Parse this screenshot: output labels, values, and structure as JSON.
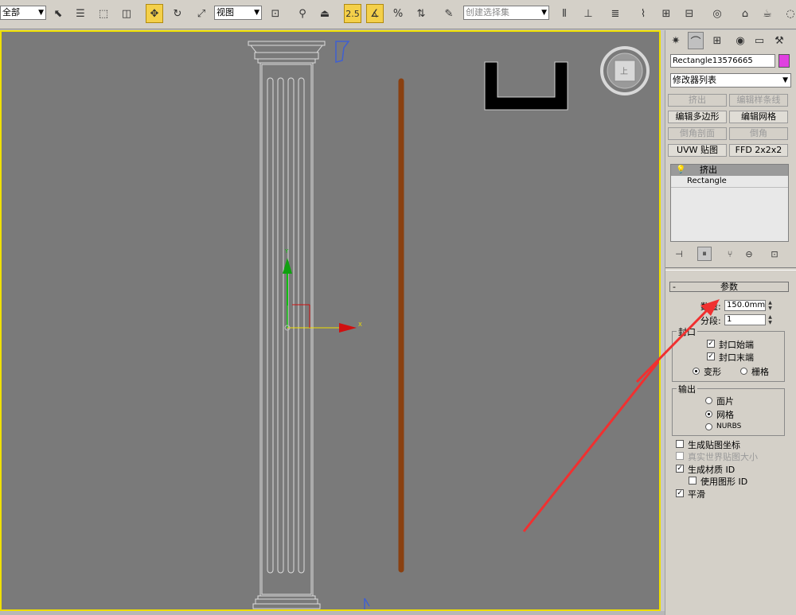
{
  "toolbar": {
    "selection_filter": "全部",
    "reference_coord": "视图",
    "snap_angle_label": "2.5",
    "named_selection_placeholder": "创建选择集"
  },
  "command_panel": {
    "object_name": "Rectangle13576665",
    "object_color": "#e040e0",
    "modifier_list": "修改器列表",
    "modifier_buttons": [
      "挤出",
      "编辑样条线",
      "编辑多边形",
      "编辑网格",
      "倒角剖面",
      "倒角",
      "UVW 贴图",
      "FFD 2x2x2"
    ],
    "modifier_buttons_disabled": [
      true,
      true,
      false,
      false,
      true,
      true,
      false,
      false
    ],
    "stack": {
      "items": [
        "挤出",
        "Rectangle"
      ]
    }
  },
  "parameters": {
    "rollout_title": "参数",
    "amount_label": "数量:",
    "amount_value": "150.0mm",
    "segments_label": "分段:",
    "segments_value": "1",
    "capping_group": "封口",
    "cap_start_label": "封口始端",
    "cap_start_checked": true,
    "cap_end_label": "封口末端",
    "cap_end_checked": true,
    "morph_label": "变形",
    "grid_label": "栅格",
    "cap_type_selected": "变形",
    "output_group": "输出",
    "output_patch": "面片",
    "output_mesh": "网格",
    "output_nurbs": "NURBS",
    "output_selected": "网格",
    "gen_mapping_label": "生成贴图坐标",
    "gen_mapping_checked": false,
    "real_world_label": "真实世界贴图大小",
    "real_world_checked": false,
    "gen_material_label": "生成材质 ID",
    "gen_material_checked": true,
    "use_shape_id_label": "使用图形 ID",
    "use_shape_id_checked": false,
    "smooth_label": "平滑",
    "smooth_checked": true
  },
  "viewport": {
    "gizmo_axis_x": "X",
    "gizmo_axis_y": "Y",
    "viewcube_label": "上",
    "accent_color": "#f0e000"
  }
}
